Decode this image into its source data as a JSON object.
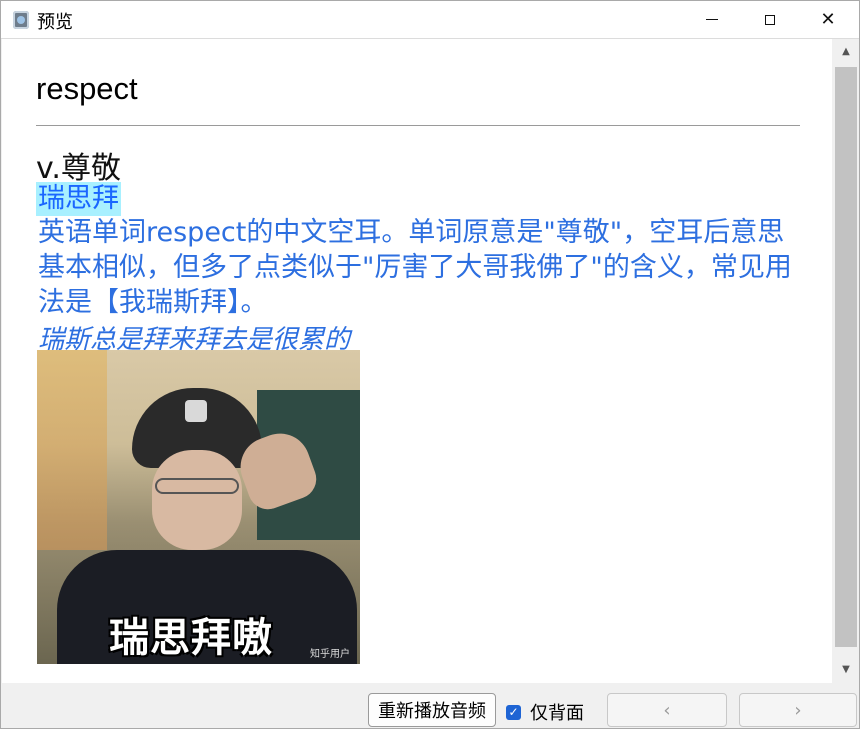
{
  "window": {
    "title": "预览",
    "app_icon": "dictionary-app-icon"
  },
  "entry": {
    "word": "respect",
    "part_of_speech": "v.尊敬",
    "highlight_term": "瑞思拜",
    "meaning": "英语单词respect的中文空耳。单词原意是\"尊敬\"，空耳后意思基本相似，但多了点类似于\"厉害了大哥我佛了\"的含义，常见用法是【我瑞斯拜】。",
    "example": "瑞斯总是拜来拜去是很累的",
    "image": {
      "caption": "瑞思拜嗷",
      "watermark": "知乎用户"
    }
  },
  "controls": {
    "replay_audio": "重新播放音频",
    "back_only_label": "仅背面",
    "back_only_checked": true,
    "prev_icon": "‹",
    "next_icon": "›"
  },
  "colors": {
    "accent": "#2d6fe0",
    "highlight_bg": "#a8f0ff",
    "checkbox": "#1e64d4"
  }
}
